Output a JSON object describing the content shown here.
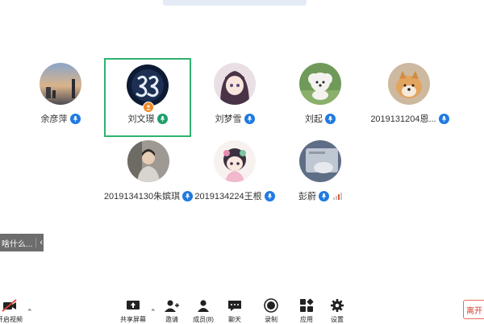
{
  "participants": [
    {
      "name": "余彦萍",
      "mic": "mic-icon",
      "avatar": "sunset-landscape"
    },
    {
      "name": "刘文璟",
      "mic": "mic-active-icon",
      "avatar": "number-33-graphic",
      "host": true
    },
    {
      "name": "刘梦雪",
      "mic": "mic-icon",
      "avatar": "anime-girl"
    },
    {
      "name": "刘起",
      "mic": "mic-icon",
      "avatar": "white-dog"
    },
    {
      "name": "2019131204恩...",
      "mic": "mic-icon",
      "avatar": "shiba-dog"
    },
    {
      "name": "2019134130朱嫔琪",
      "mic": "mic-icon",
      "avatar": "person-photo"
    },
    {
      "name": "2019134224王根",
      "mic": "mic-icon",
      "avatar": "cartoon-girl"
    },
    {
      "name": "彭蔚",
      "mic": "mic-icon",
      "avatar": "grey-object"
    }
  ],
  "chat_preview": {
    "text": "啥什么...",
    "collapse_icon": "chevron-left-icon"
  },
  "toolbar": {
    "video_label": "开启视频",
    "share_label": "共享屏幕",
    "invite_label": "邀请",
    "members_label": "成员(8)",
    "chat_label": "聊天",
    "record_label": "录制",
    "apps_label": "应用",
    "settings_label": "设置"
  },
  "leave_label": "离开",
  "colors": {
    "active_border": "#2fb36f",
    "mic_blue": "#1f7ae0",
    "mic_green": "#1f9f6a",
    "leave_red": "#d33c2d"
  }
}
